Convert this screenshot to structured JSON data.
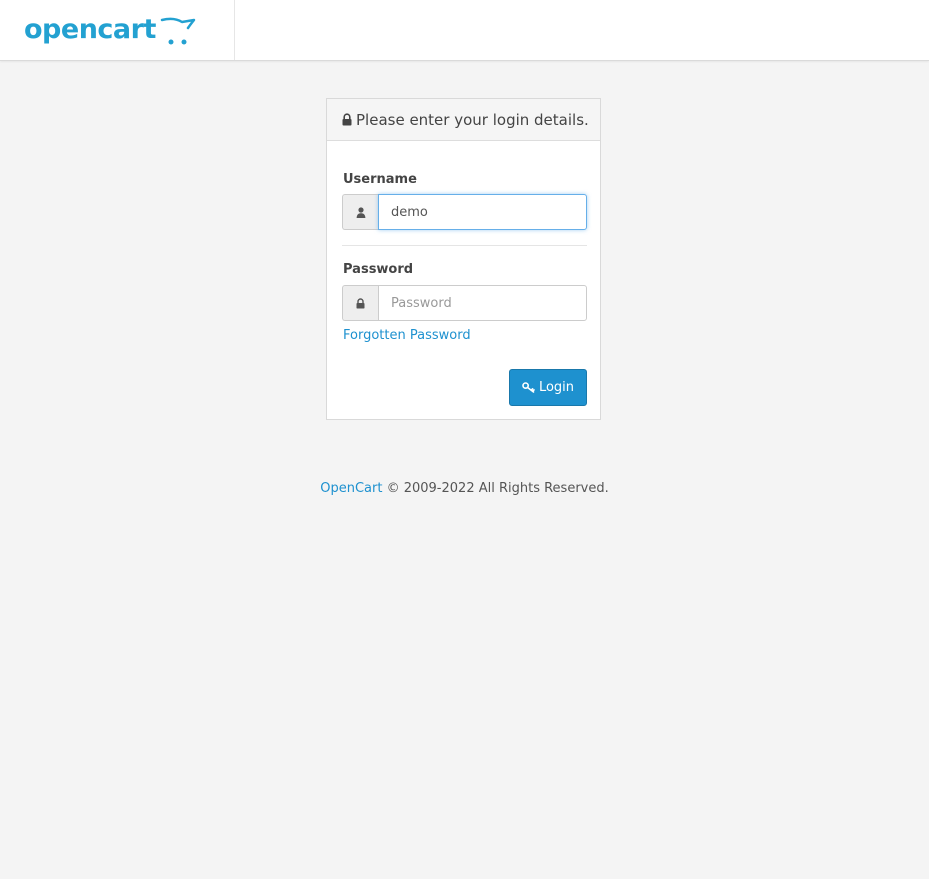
{
  "header": {
    "logo_text": "opencart",
    "logo_color": "#23a1d1"
  },
  "login_panel": {
    "title": "Please enter your login details.",
    "title_icon": "lock-icon",
    "username": {
      "label": "Username",
      "value": "demo",
      "icon": "user-icon"
    },
    "password": {
      "label": "Password",
      "placeholder": "Password",
      "value": "",
      "icon": "lock-icon"
    },
    "forgot_link": "Forgotten Password",
    "login_button": {
      "label": "Login",
      "icon": "key-icon",
      "color": "#1e91cf"
    }
  },
  "footer": {
    "link_text": "OpenCart",
    "text": "© 2009-2022 All Rights Reserved."
  }
}
